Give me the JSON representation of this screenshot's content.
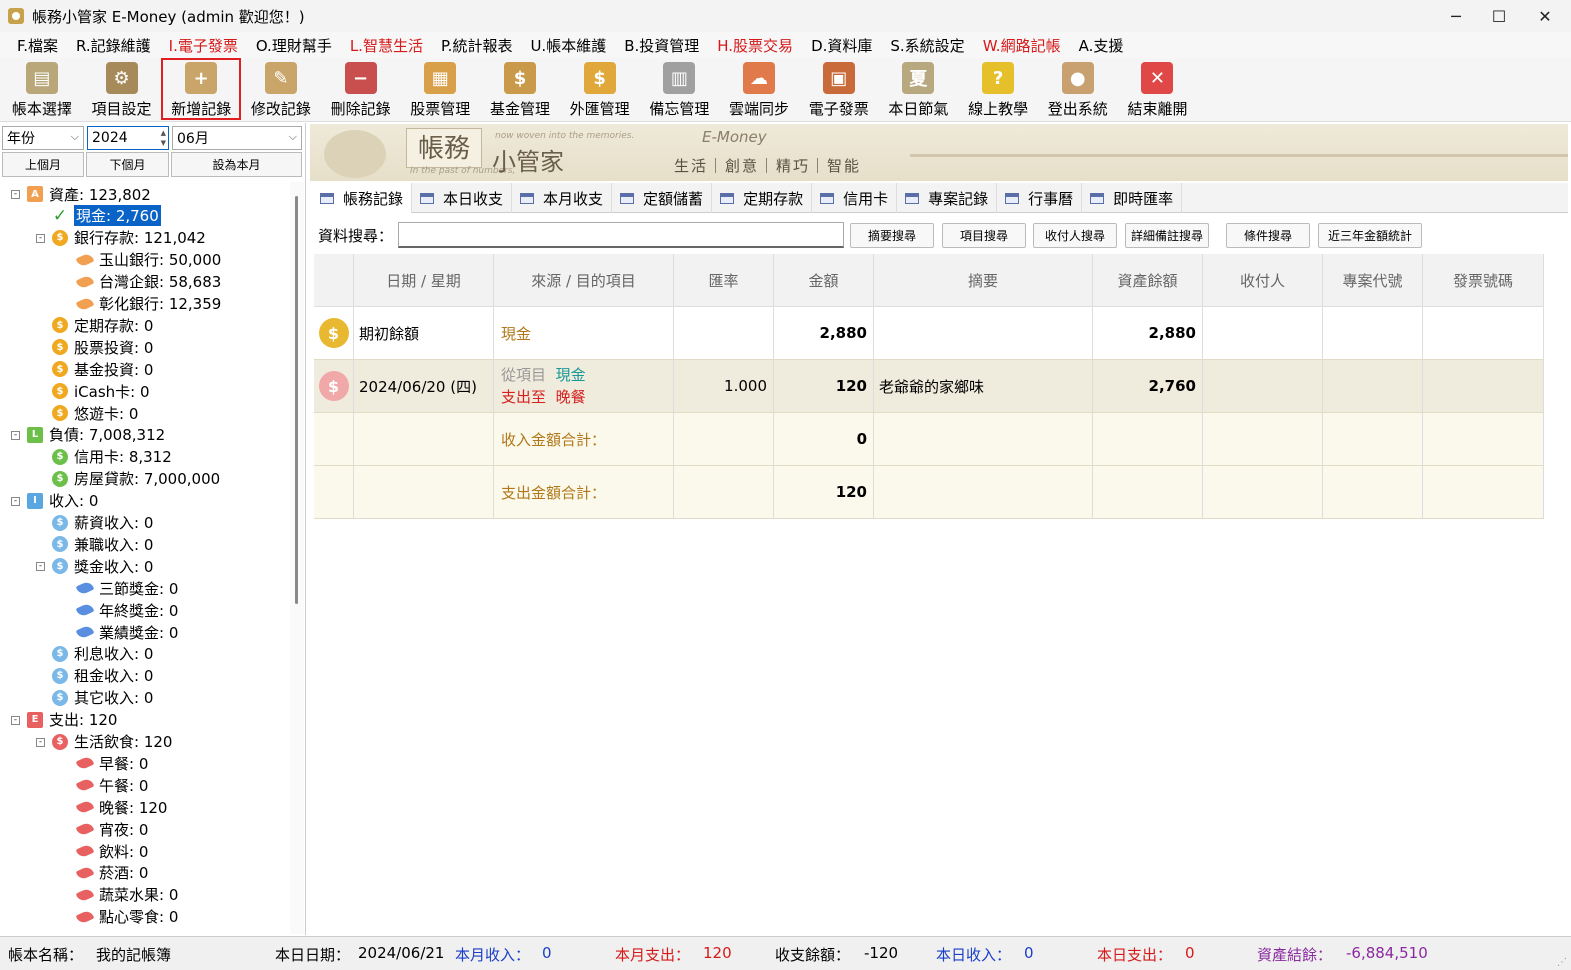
{
  "window": {
    "title": "帳務小管家 E-Money (admin 歡迎您！)",
    "controls": {
      "minimize": "─",
      "maximize": "☐",
      "close": "✕"
    }
  },
  "menu": [
    {
      "label": "F.檔案",
      "red": false
    },
    {
      "label": "R.記錄維護",
      "red": false
    },
    {
      "label": "I.電子發票",
      "red": true
    },
    {
      "label": "O.理財幫手",
      "red": false
    },
    {
      "label": "L.智慧生活",
      "red": true
    },
    {
      "label": "P.統計報表",
      "red": false
    },
    {
      "label": "U.帳本維護",
      "red": false
    },
    {
      "label": "B.投資管理",
      "red": false
    },
    {
      "label": "H.股票交易",
      "red": true
    },
    {
      "label": "D.資料庫",
      "red": false
    },
    {
      "label": "S.系統設定",
      "red": false
    },
    {
      "label": "W.網路記帳",
      "red": true
    },
    {
      "label": "A.支援",
      "red": false
    }
  ],
  "toolbar": [
    {
      "label": "帳本選擇",
      "icon": "ledger-icon",
      "glyph": "▤",
      "color": "#b9a77a"
    },
    {
      "label": "項目設定",
      "icon": "settings-icon",
      "glyph": "⚙",
      "color": "#a68a5a"
    },
    {
      "label": "新增記錄",
      "icon": "add-record-icon",
      "glyph": "+",
      "color": "#c9a56a",
      "active": true
    },
    {
      "label": "修改記錄",
      "icon": "edit-record-icon",
      "glyph": "✎",
      "color": "#c9a56a"
    },
    {
      "label": "刪除記錄",
      "icon": "delete-record-icon",
      "glyph": "−",
      "color": "#c94f4f"
    },
    {
      "label": "股票管理",
      "icon": "stock-icon",
      "glyph": "▦",
      "color": "#d9a04a"
    },
    {
      "label": "基金管理",
      "icon": "fund-icon",
      "glyph": "$",
      "color": "#c99a4a"
    },
    {
      "label": "外匯管理",
      "icon": "forex-icon",
      "glyph": "$",
      "color": "#e0a83a"
    },
    {
      "label": "備忘管理",
      "icon": "memo-icon",
      "glyph": "▥",
      "color": "#a0a0a0"
    },
    {
      "label": "雲端同步",
      "icon": "cloud-sync-icon",
      "glyph": "☁",
      "color": "#e07a4a"
    },
    {
      "label": "電子發票",
      "icon": "qrcode-icon",
      "glyph": "▣",
      "color": "#c86a3a"
    },
    {
      "label": "本日節氣",
      "icon": "solar-term-icon",
      "glyph": "夏",
      "color": "#b8a880"
    },
    {
      "label": "線上教學",
      "icon": "help-icon",
      "glyph": "?",
      "color": "#e6c02a"
    },
    {
      "label": "登出系統",
      "icon": "logout-user-icon",
      "glyph": "●",
      "color": "#c9a070"
    },
    {
      "label": "結束離開",
      "icon": "exit-icon",
      "glyph": "✕",
      "color": "#e04848"
    }
  ],
  "period": {
    "mode": "年份",
    "year": "2024",
    "month": "06月",
    "prev": "上個月",
    "next": "下個月",
    "current": "設為本月"
  },
  "tree": [
    {
      "label": "資產: 123,802",
      "level": 0,
      "icon": "asset-icon",
      "badge": "A",
      "color": "#f0a050",
      "shape": "sq",
      "exp": "-"
    },
    {
      "label": "現金: 2,760",
      "level": 1,
      "icon": "check-icon",
      "badge": "✓",
      "color": "#2aa02a",
      "shape": "check",
      "selected": true
    },
    {
      "label": "銀行存款: 121,042",
      "level": 1,
      "icon": "coin-icon",
      "badge": "$",
      "color": "#f0a820",
      "shape": "circ",
      "exp": "-"
    },
    {
      "label": "玉山銀行: 50,000",
      "level": 2,
      "icon": "leaf-icon",
      "color": "#f0a050",
      "shape": "leaf"
    },
    {
      "label": "台灣企銀: 58,683",
      "level": 2,
      "icon": "leaf-icon",
      "color": "#f0a050",
      "shape": "leaf"
    },
    {
      "label": "彰化銀行: 12,359",
      "level": 2,
      "icon": "leaf-icon",
      "color": "#f0a050",
      "shape": "leaf"
    },
    {
      "label": "定期存款: 0",
      "level": 1,
      "icon": "coin-icon",
      "badge": "$",
      "color": "#f0a820",
      "shape": "circ"
    },
    {
      "label": "股票投資: 0",
      "level": 1,
      "icon": "coin-icon",
      "badge": "$",
      "color": "#f0a820",
      "shape": "circ"
    },
    {
      "label": "基金投資: 0",
      "level": 1,
      "icon": "coin-icon",
      "badge": "$",
      "color": "#f0a820",
      "shape": "circ"
    },
    {
      "label": "iCash卡: 0",
      "level": 1,
      "icon": "coin-icon",
      "badge": "$",
      "color": "#f0a820",
      "shape": "circ"
    },
    {
      "label": "悠遊卡: 0",
      "level": 1,
      "icon": "coin-icon",
      "badge": "$",
      "color": "#f0a820",
      "shape": "circ"
    },
    {
      "label": "負債: 7,008,312",
      "level": 0,
      "icon": "liability-icon",
      "badge": "L",
      "color": "#6cc04a",
      "shape": "sq",
      "exp": "-"
    },
    {
      "label": "信用卡: 8,312",
      "level": 1,
      "icon": "coin-icon",
      "badge": "$",
      "color": "#6cc04a",
      "shape": "circ"
    },
    {
      "label": "房屋貸款: 7,000,000",
      "level": 1,
      "icon": "coin-icon",
      "badge": "$",
      "color": "#6cc04a",
      "shape": "circ"
    },
    {
      "label": "收入: 0",
      "level": 0,
      "icon": "income-icon",
      "badge": "I",
      "color": "#5aa6e0",
      "shape": "sq",
      "exp": "-"
    },
    {
      "label": "薪資收入: 0",
      "level": 1,
      "icon": "coin-icon",
      "badge": "$",
      "color": "#7ab8e8",
      "shape": "circ"
    },
    {
      "label": "兼職收入: 0",
      "level": 1,
      "icon": "coin-icon",
      "badge": "$",
      "color": "#7ab8e8",
      "shape": "circ"
    },
    {
      "label": "獎金收入: 0",
      "level": 1,
      "icon": "coin-icon",
      "badge": "$",
      "color": "#7ab8e8",
      "shape": "circ",
      "exp": "-"
    },
    {
      "label": "三節獎金: 0",
      "level": 2,
      "icon": "leaf-icon",
      "color": "#5a8ee0",
      "shape": "leaf"
    },
    {
      "label": "年終獎金: 0",
      "level": 2,
      "icon": "leaf-icon",
      "color": "#5a8ee0",
      "shape": "leaf"
    },
    {
      "label": "業績獎金: 0",
      "level": 2,
      "icon": "leaf-icon",
      "color": "#5a8ee0",
      "shape": "leaf"
    },
    {
      "label": "利息收入: 0",
      "level": 1,
      "icon": "coin-icon",
      "badge": "$",
      "color": "#7ab8e8",
      "shape": "circ"
    },
    {
      "label": "租金收入: 0",
      "level": 1,
      "icon": "coin-icon",
      "badge": "$",
      "color": "#7ab8e8",
      "shape": "circ"
    },
    {
      "label": "其它收入: 0",
      "level": 1,
      "icon": "coin-icon",
      "badge": "$",
      "color": "#7ab8e8",
      "shape": "circ"
    },
    {
      "label": "支出: 120",
      "level": 0,
      "icon": "expense-icon",
      "badge": "E",
      "color": "#e86060",
      "shape": "sq",
      "exp": "-"
    },
    {
      "label": "生活飲食: 120",
      "level": 1,
      "icon": "coin-icon",
      "badge": "$",
      "color": "#e86060",
      "shape": "circ",
      "exp": "-"
    },
    {
      "label": "早餐: 0",
      "level": 2,
      "icon": "leaf-icon",
      "color": "#e86060",
      "shape": "leaf"
    },
    {
      "label": "午餐: 0",
      "level": 2,
      "icon": "leaf-icon",
      "color": "#e86060",
      "shape": "leaf"
    },
    {
      "label": "晚餐: 120",
      "level": 2,
      "icon": "leaf-icon",
      "color": "#e86060",
      "shape": "leaf"
    },
    {
      "label": "宵夜: 0",
      "level": 2,
      "icon": "leaf-icon",
      "color": "#e86060",
      "shape": "leaf"
    },
    {
      "label": "飲料: 0",
      "level": 2,
      "icon": "leaf-icon",
      "color": "#e86060",
      "shape": "leaf"
    },
    {
      "label": "菸酒: 0",
      "level": 2,
      "icon": "leaf-icon",
      "color": "#e86060",
      "shape": "leaf"
    },
    {
      "label": "蔬菜水果: 0",
      "level": 2,
      "icon": "leaf-icon",
      "color": "#e86060",
      "shape": "leaf"
    },
    {
      "label": "點心零食: 0",
      "level": 2,
      "icon": "leaf-icon",
      "color": "#e86060",
      "shape": "leaf"
    }
  ],
  "banner": {
    "title1": "帳務",
    "title2": "小管家",
    "brand": "E-Money",
    "tagline_top": "now woven into the memories.",
    "tagline_bottom": "In the past of numbers,",
    "slogan": "生活｜創意｜精巧｜智能"
  },
  "tabs": [
    "帳務記錄",
    "本日收支",
    "本月收支",
    "定額儲蓄",
    "定期存款",
    "信用卡",
    "專案記錄",
    "行事曆",
    "即時匯率"
  ],
  "search": {
    "label": "資料搜尋：",
    "value": "",
    "buttons": [
      "摘要搜尋",
      "項目搜尋",
      "收付人搜尋",
      "詳細備註搜尋",
      "條件搜尋",
      "近三年金額統計"
    ]
  },
  "grid": {
    "columns": [
      "",
      "日期 / 星期",
      "來源 / 目的項目",
      "匯率",
      "金額",
      "摘要",
      "資產餘額",
      "收付人",
      "專案代號",
      "發票號碼"
    ],
    "opening": {
      "date": "期初餘額",
      "item": "現金",
      "amount": "2,880",
      "balance": "2,880",
      "icon": "money-bag-icon"
    },
    "entry": {
      "date": "2024/06/20 (四)",
      "from_prefix": "從項目",
      "from_item": "現金",
      "to_prefix": "支出至",
      "to_item": "晚餐",
      "rate": "1.000",
      "amount": "120",
      "summary": "老爺爺的家鄉味",
      "balance": "2,760",
      "icon": "dollar-icon"
    },
    "income_total": {
      "label": "收入金額合計：",
      "amount": "0"
    },
    "expense_total": {
      "label": "支出金額合計：",
      "amount": "120"
    }
  },
  "status": {
    "ledger_label": "帳本名稱：",
    "ledger_name": "我的記帳簿",
    "date_label": "本日日期：",
    "date": "2024/06/21",
    "month_income_label": "本月收入：",
    "month_income": "0",
    "month_expense_label": "本月支出：",
    "month_expense": "120",
    "balance_label": "收支餘額：",
    "balance": "-120",
    "day_income_label": "本日收入：",
    "day_income": "0",
    "day_expense_label": "本日支出：",
    "day_expense": "0",
    "asset_label": "資產結餘：",
    "asset": "-6,884,510"
  }
}
